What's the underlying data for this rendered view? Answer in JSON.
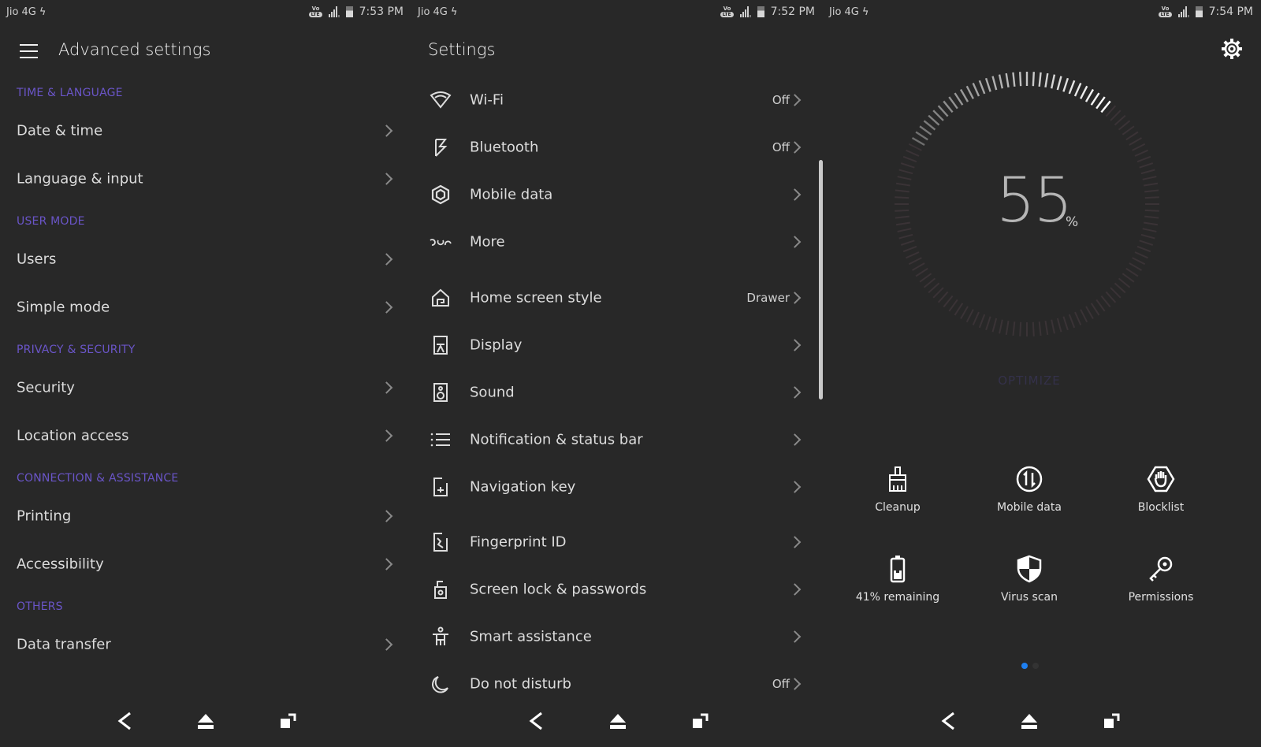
{
  "accent_color": "#6a55c8",
  "panels": {
    "advanced": {
      "status": {
        "carrier": "Jio 4G",
        "time": "7:53 PM"
      },
      "title": "Advanced settings",
      "sections": [
        {
          "header": "TIME & LANGUAGE",
          "items": [
            "Date & time",
            "Language & input"
          ]
        },
        {
          "header": "USER MODE",
          "items": [
            "Users",
            "Simple mode"
          ]
        },
        {
          "header": "PRIVACY & SECURITY",
          "items": [
            "Security",
            "Location access"
          ]
        },
        {
          "header": "CONNECTION & ASSISTANCE",
          "items": [
            "Printing",
            "Accessibility"
          ]
        },
        {
          "header": "OTHERS",
          "items": [
            "Data transfer"
          ]
        }
      ]
    },
    "settings": {
      "status": {
        "carrier": "Jio 4G",
        "time": "7:52 PM"
      },
      "title": "Settings",
      "items": [
        {
          "icon": "wifi-icon",
          "label": "Wi-Fi",
          "value": "Off"
        },
        {
          "icon": "bluetooth-icon",
          "label": "Bluetooth",
          "value": "Off"
        },
        {
          "icon": "mobile-data-icon",
          "label": "Mobile data",
          "value": ""
        },
        {
          "icon": "more-icon",
          "label": "More",
          "value": ""
        },
        {
          "icon": "home-icon",
          "label": "Home screen style",
          "value": "Drawer"
        },
        {
          "icon": "display-icon",
          "label": "Display",
          "value": ""
        },
        {
          "icon": "sound-icon",
          "label": "Sound",
          "value": ""
        },
        {
          "icon": "notification-icon",
          "label": "Notification & status bar",
          "value": ""
        },
        {
          "icon": "navigation-key-icon",
          "label": "Navigation key",
          "value": ""
        },
        {
          "icon": "fingerprint-icon",
          "label": "Fingerprint ID",
          "value": ""
        },
        {
          "icon": "screen-lock-icon",
          "label": "Screen lock & passwords",
          "value": ""
        },
        {
          "icon": "smart-assistance-icon",
          "label": "Smart assistance",
          "value": ""
        },
        {
          "icon": "moon-icon",
          "label": "Do not disturb",
          "value": "Off"
        }
      ]
    },
    "manager": {
      "status": {
        "carrier": "Jio 4G",
        "time": "7:54 PM"
      },
      "score": "55",
      "score_unit": "%",
      "score_fraction": 0.55,
      "optimize_label": "OPTIMIZE",
      "tools": [
        {
          "icon": "cleanup-icon",
          "label": "Cleanup"
        },
        {
          "icon": "mobile-data-icon",
          "label": "Mobile data"
        },
        {
          "icon": "blocklist-icon",
          "label": "Blocklist"
        },
        {
          "icon": "battery-icon",
          "label": "41% remaining"
        },
        {
          "icon": "virus-scan-icon",
          "label": "Virus scan"
        },
        {
          "icon": "permissions-icon",
          "label": "Permissions"
        }
      ],
      "page_indicator": {
        "current": 1,
        "total": 2
      }
    }
  }
}
